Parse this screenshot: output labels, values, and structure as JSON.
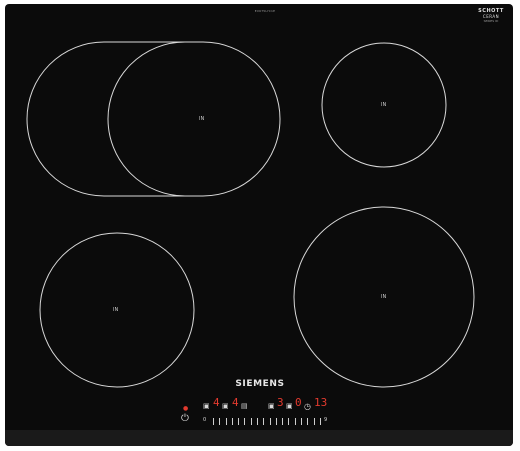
{
  "hob": {
    "model_number": "EX675LYC1E",
    "ceramic_brand": {
      "line1": "SCHOTT",
      "line2": "CERAN",
      "line3": "SERIES ID"
    },
    "brand": "SIEMENS",
    "zone_label": "IN",
    "colors": {
      "glass": "#0b0b0b",
      "zone_outline": "#d9d9d9",
      "indicator_red": "#e23a2e"
    }
  },
  "controls": {
    "power_icon": "power-icon",
    "zone_left_level": "4",
    "zone_right_level": "3",
    "zone_right_sub": "0",
    "timer_value": "13",
    "slider_min": "0",
    "slider_max": "9"
  }
}
